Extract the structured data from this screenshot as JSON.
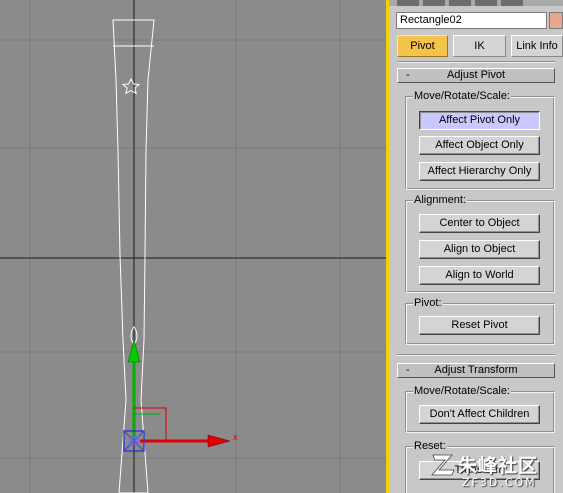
{
  "viewport": {
    "axis_x_label": "x"
  },
  "panel": {
    "tabs": [
      {
        "icon": "create-tab-icon"
      },
      {
        "icon": "modify-tab-icon"
      },
      {
        "icon": "hierarchy-tab-icon"
      },
      {
        "icon": "motion-tab-icon"
      },
      {
        "icon": "display-tab-icon"
      }
    ],
    "object_name": "Rectangle02",
    "object_color": "#e8a88a",
    "subtabs": [
      {
        "label": "Pivot",
        "active": true
      },
      {
        "label": "IK",
        "active": false
      },
      {
        "label": "Link Info",
        "active": false
      }
    ],
    "adjust_pivot": {
      "collapse_symbol": "-",
      "title": "Adjust Pivot",
      "move_group": {
        "label": "Move/Rotate/Scale:",
        "buttons": [
          "Affect Pivot Only",
          "Affect Object Only",
          "Affect Hierarchy Only"
        ],
        "pressed": "Affect Pivot Only"
      },
      "alignment_group": {
        "label": "Alignment:",
        "buttons": [
          "Center to Object",
          "Align to Object",
          "Align to World"
        ]
      },
      "pivot_group": {
        "label": "Pivot:",
        "buttons": [
          "Reset Pivot"
        ]
      }
    },
    "adjust_transform": {
      "collapse_symbol": "-",
      "title": "Adjust Transform",
      "move_group": {
        "label": "Move/Rotate/Scale:",
        "buttons": [
          "Don't Affect Children"
        ]
      },
      "reset_group": {
        "label": "Reset:",
        "buttons": [
          "Transform"
        ]
      }
    }
  },
  "watermark": {
    "brand": "朱峰社区",
    "url": "ZF3D.COM"
  },
  "colors": {
    "active_tab": "#f5c34a",
    "pressed_button": "#c9c9ff",
    "viewport_border": "#f0d000",
    "axis_x": "#e00000",
    "axis_y": "#00b000",
    "pivot_box": "#3a3acc"
  }
}
